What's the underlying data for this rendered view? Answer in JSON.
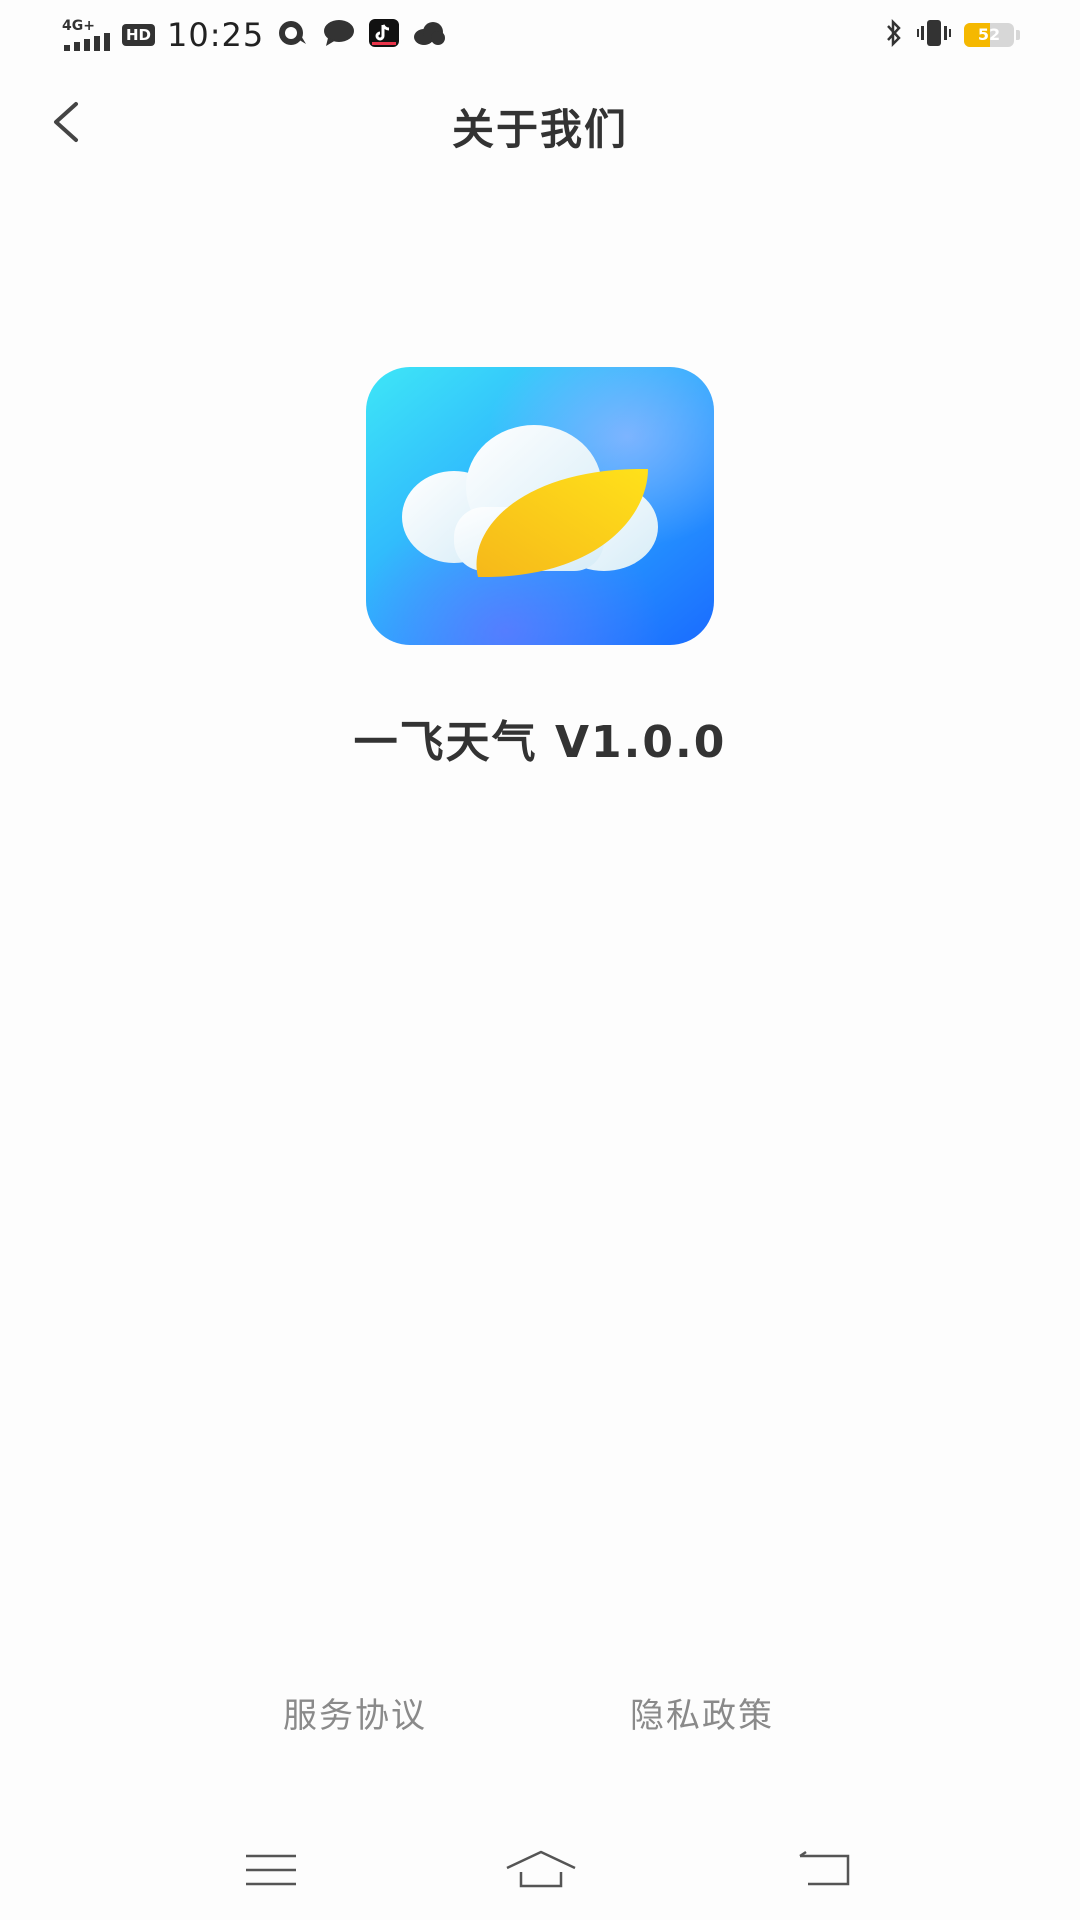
{
  "status_bar": {
    "network": "4G+",
    "hd": "HD",
    "time": "10:25",
    "battery": {
      "level": 52,
      "text": "52",
      "color": "#f5b800"
    },
    "icons": [
      "signal-icon",
      "hd-icon",
      "qq-icon",
      "message-icon",
      "tiktok-icon",
      "cloud-icon",
      "bluetooth-icon",
      "vibrate-icon",
      "battery-icon"
    ]
  },
  "header": {
    "title": "关于我们",
    "back_icon": "chevron-left-icon"
  },
  "app": {
    "logo_icon": "weather-app-logo-icon",
    "name_version": "一飞天气  V1.0.0"
  },
  "footer_links": {
    "terms": "服务协议",
    "privacy": "隐私政策"
  },
  "nav_bar": {
    "icons": [
      "menu-icon",
      "home-icon",
      "back-icon"
    ]
  },
  "colors": {
    "text_primary": "#333333",
    "text_secondary": "#8a8a8a",
    "logo_gradient_start": "#3ee6f7",
    "logo_gradient_end": "#1a6bff",
    "leaf": "#f7c51b"
  }
}
